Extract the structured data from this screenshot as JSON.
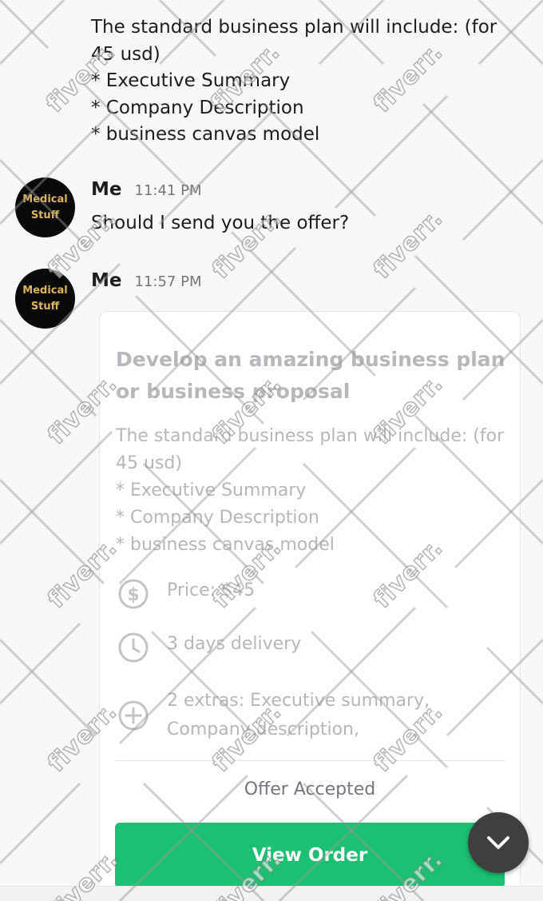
{
  "messages": [
    {
      "text": "The standard business plan will include: (for 45 usd)\n* Executive Summary\n* Company Description\n* business canvas model"
    },
    {
      "sender": "Me",
      "time": "11:41 PM",
      "avatar_lines": [
        "Medical",
        "Stuff"
      ],
      "text": "Should I send you the offer?"
    },
    {
      "sender": "Me",
      "time": "11:57 PM",
      "avatar_lines": [
        "Medical",
        "Stuff"
      ]
    }
  ],
  "offer": {
    "title": "Develop an amazing business plan or business proposal",
    "description": "The standard business plan will include: (for 45 usd)\n* Executive Summary\n* Company Description\n* business canvas model",
    "details": [
      {
        "icon": "dollar-icon",
        "text": "Price: $45"
      },
      {
        "icon": "clock-icon",
        "text": "3 days delivery"
      },
      {
        "icon": "plus-circle-icon",
        "text": "2 extras: Executive summary, Company description,"
      }
    ],
    "status": "Offer Accepted",
    "button_label": "View Order"
  },
  "watermark": {
    "text": "fiverr."
  },
  "colors": {
    "accent_green": "#1dbf73",
    "avatar_gold": "#d9b45a",
    "muted_text": "#b6b7ba",
    "fab_bg": "#3f3f3f"
  }
}
